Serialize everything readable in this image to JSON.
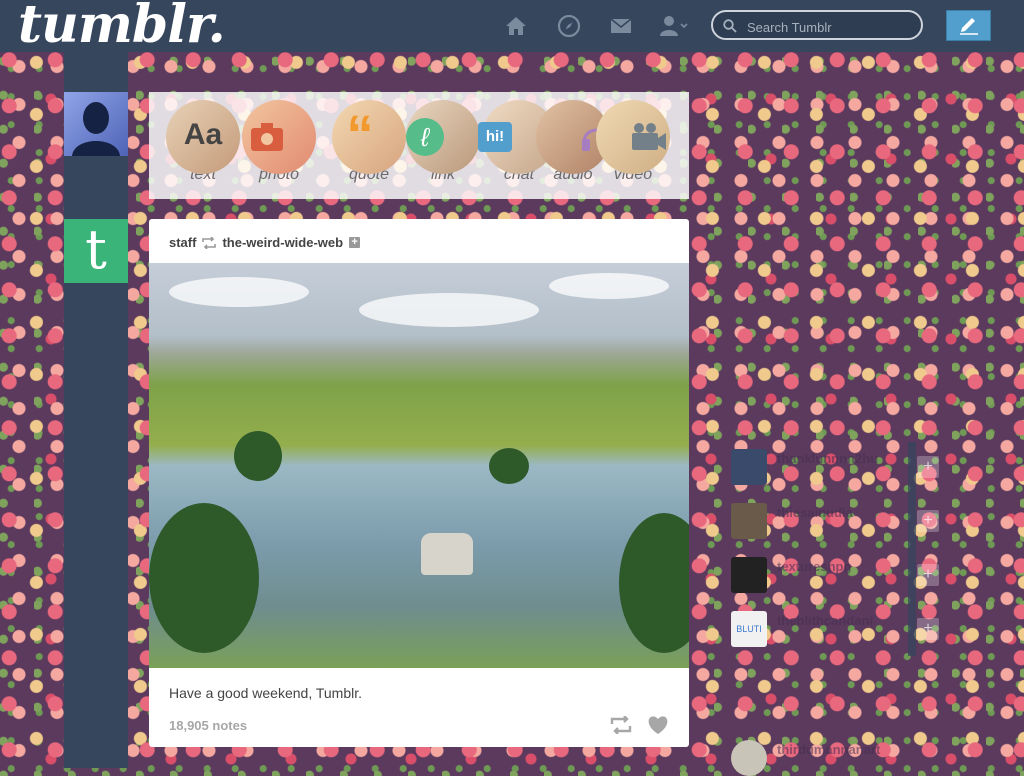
{
  "header": {
    "logo": "tumblr.",
    "search_placeholder": "Search Tumblr",
    "nav": [
      "home-icon",
      "explore-icon",
      "inbox-icon",
      "account-icon"
    ],
    "compose_icon": "pencil-icon",
    "colors": {
      "navy": "#36465d",
      "compose": "#529ecc"
    }
  },
  "post_types": [
    {
      "label": "text",
      "icon": "Aa",
      "color": "#444444"
    },
    {
      "label": "photo",
      "icon": "camera",
      "color": "#d95e40"
    },
    {
      "label": "quote",
      "icon": "“",
      "color": "#f2992e"
    },
    {
      "label": "link",
      "icon": "ℓ",
      "color": "#56bc8a"
    },
    {
      "label": "chat",
      "icon": "hi!",
      "color": "#529ecc"
    },
    {
      "label": "audio",
      "icon": "headphones",
      "color": "#a77dc2"
    },
    {
      "label": "video",
      "icon": "video-camera",
      "color": "#748089"
    }
  ],
  "post": {
    "author": "staff",
    "reblogged_from": "the-weird-wide-web",
    "caption": "Have a good weekend, Tumblr.",
    "notes": "18,905 notes"
  },
  "sidebar": {
    "recommended": [
      {
        "name": "thanklunnnn2hu",
        "avatar_color": "#3a4a6a"
      },
      {
        "name": "thiesainudia",
        "avatar_color": "#6a5a4a"
      },
      {
        "name": "texturesnpg",
        "avatar_color": "#222222"
      },
      {
        "name": "theblithcandani",
        "avatar_color": "#f1f1f1"
      }
    ],
    "bottom_name": "thirdumannanart"
  }
}
